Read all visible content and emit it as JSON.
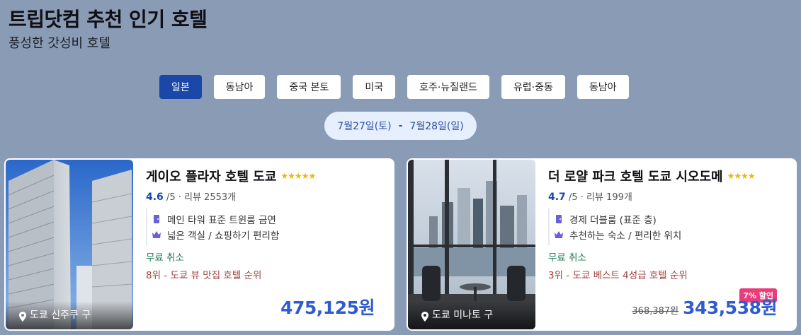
{
  "header": {
    "title": "트립닷컴 추천 인기 호텔",
    "subtitle": "풍성한 갓성비 호텔"
  },
  "tabs": [
    {
      "label": "일본",
      "active": true
    },
    {
      "label": "동남아",
      "active": false
    },
    {
      "label": "중국 본토",
      "active": false
    },
    {
      "label": "미국",
      "active": false
    },
    {
      "label": "호주·뉴질랜드",
      "active": false
    },
    {
      "label": "유럽·중동",
      "active": false
    },
    {
      "label": "동남아",
      "active": false
    }
  ],
  "dates": {
    "checkin": "7월27일(토)",
    "separator": "-",
    "checkout": "7월28일(일)"
  },
  "hotels": [
    {
      "name": "게이오 플라자 호텔 도쿄",
      "stars": "★★★★★",
      "score": "4.6",
      "rating_rest": "/5 · 리뷰 2553개",
      "tag1": "메인 타워 표준 트윈룸 금연",
      "tag2": "넓은 객실 / 쇼핑하기 편리함",
      "free_cancel": "무료 취소",
      "rank": "8위 - 도쿄 뷰 맛집 호텔 순위",
      "location": "도쿄 신주쿠 구",
      "price": "475,125원"
    },
    {
      "name": "더 로얄 파크 호텔 도쿄 시오도메",
      "stars": "★★★★",
      "score": "4.7",
      "rating_rest": "/5 · 리뷰 199개",
      "tag1": "경제 더블룸 (표준 층)",
      "tag2": "추천하는 숙소 / 편리한 위치",
      "free_cancel": "무료 취소",
      "rank": "3위 - 도쿄 베스트 4성급 호텔 순위",
      "location": "도쿄 미나토 구",
      "discount": "7% 할인",
      "original_price": "368,387원",
      "price": "343,538원"
    }
  ],
  "colors": {
    "background": "#8a9bb6",
    "accent": "#1b47a8",
    "price": "#2f5bd0",
    "free_cancel": "#1e7f55",
    "rank": "#a0403c",
    "discount": "#e73d7a"
  }
}
